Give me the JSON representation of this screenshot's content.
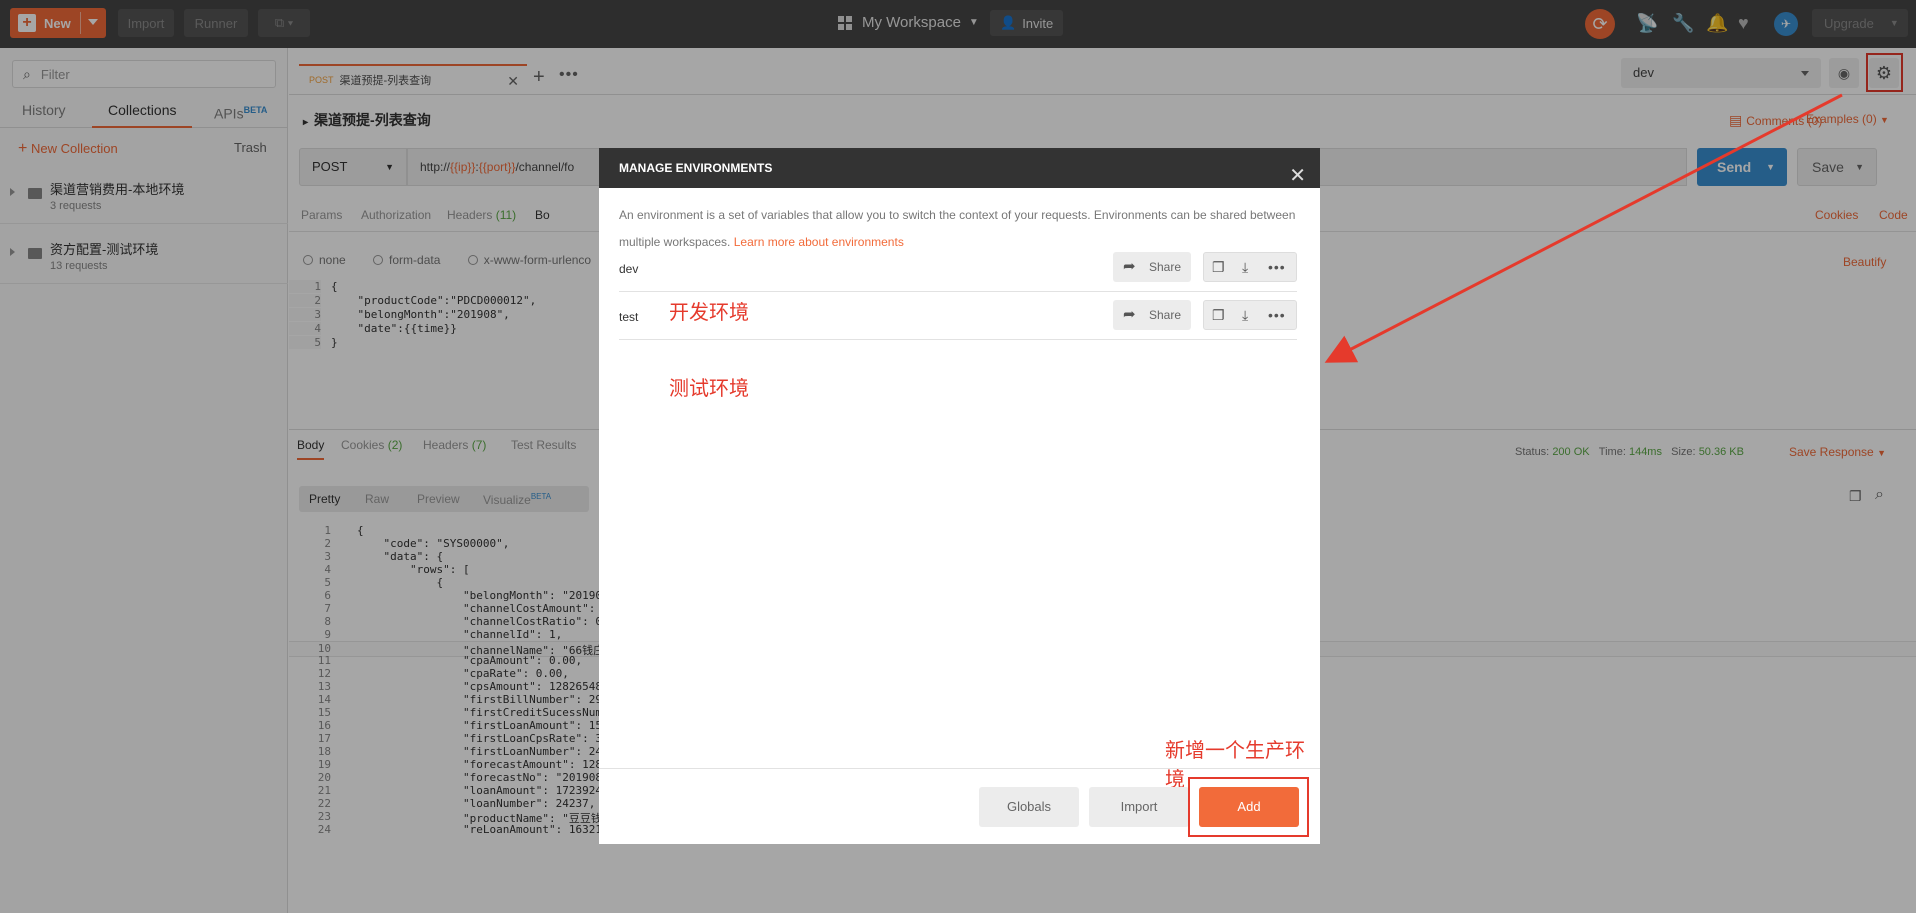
{
  "topbar": {
    "new_label": "New",
    "import_label": "Import",
    "runner_label": "Runner",
    "workspace_label": "My Workspace",
    "invite_label": "Invite",
    "upgrade_label": "Upgrade"
  },
  "sidebar": {
    "filter_placeholder": "Filter",
    "tabs": [
      "History",
      "Collections",
      "APIs"
    ],
    "apis_badge": "BETA",
    "new_collection": "New Collection",
    "trash": "Trash",
    "collections": [
      {
        "name": "渠道营销费用-本地环境",
        "count": "3 requests"
      },
      {
        "name": "资方配置-测试环境",
        "count": "13 requests"
      }
    ]
  },
  "request": {
    "tab_method": "POST",
    "tab_name": "渠道预提-列表查询",
    "title": "渠道预提-列表查询",
    "comments": "Comments (0)",
    "examples": "Examples (0)",
    "method": "POST",
    "url_prefix": "http://",
    "url_var1": "{{ip}}",
    "url_colon": ":",
    "url_var2": "{{port}}",
    "url_suffix": "/channel/fo",
    "send": "Send",
    "save": "Save",
    "env_selected": "dev",
    "subtabs": [
      "Params",
      "Authorization",
      "Headers",
      "(11)",
      "Bo"
    ],
    "cookies": "Cookies",
    "code": "Code",
    "body_modes": [
      "none",
      "form-data",
      "x-www-form-urlenco"
    ],
    "beautify": "Beautify",
    "body_lines": [
      {
        "n": "1",
        "t": "{"
      },
      {
        "n": "2",
        "t": "    \"productCode\":\"PDCD000012\","
      },
      {
        "n": "3",
        "t": "    \"belongMonth\":\"201908\","
      },
      {
        "n": "4",
        "t": "    \"date\":{{time}}"
      },
      {
        "n": "5",
        "t": "}"
      }
    ]
  },
  "response": {
    "tabs": [
      "Body",
      "Cookies",
      "(2)",
      "Headers",
      "(7)",
      "Test Results"
    ],
    "status_label": "Status:",
    "status_value": "200 OK",
    "time_label": "Time:",
    "time_value": "144ms",
    "size_label": "Size:",
    "size_value": "50.36 KB",
    "save_response": "Save Response",
    "view_modes": [
      "Pretty",
      "Raw",
      "Preview",
      "Visualize"
    ],
    "visualize_badge": "BETA",
    "lines": [
      {
        "n": "1",
        "t": "{"
      },
      {
        "n": "2",
        "t": "    \"code\": \"SYS00000\","
      },
      {
        "n": "3",
        "t": "    \"data\": {"
      },
      {
        "n": "4",
        "t": "        \"rows\": ["
      },
      {
        "n": "5",
        "t": "            {"
      },
      {
        "n": "6",
        "t": "                \"belongMonth\": \"20190"
      },
      {
        "n": "7",
        "t": "                \"channelCostAmount\":"
      },
      {
        "n": "8",
        "t": "                \"channelCostRatio\": 0"
      },
      {
        "n": "9",
        "t": "                \"channelId\": 1,"
      },
      {
        "n": "10",
        "t": "                \"channelName\": \"66钱庄"
      },
      {
        "n": "11",
        "t": "                \"cpaAmount\": 0.00,"
      },
      {
        "n": "12",
        "t": "                \"cpaRate\": 0.00,"
      },
      {
        "n": "13",
        "t": "                \"cpsAmount\": 12826548"
      },
      {
        "n": "14",
        "t": "                \"firstBillNumber\": 29"
      },
      {
        "n": "15",
        "t": "                \"firstCreditSucessNum"
      },
      {
        "n": "16",
        "t": "                \"firstLoanAmount\": 15"
      },
      {
        "n": "17",
        "t": "                \"firstLoanCpsRate\": 3"
      },
      {
        "n": "18",
        "t": "                \"firstLoanNumber\": 24"
      },
      {
        "n": "19",
        "t": "                \"forecastAmount\": 128"
      },
      {
        "n": "20",
        "t": "                \"forecastNo\": \"201908"
      },
      {
        "n": "21",
        "t": "                \"loanAmount\": 1723924.95,"
      },
      {
        "n": "22",
        "t": "                \"loanNumber\": 24237,"
      },
      {
        "n": "23",
        "t": "                \"productName\": \"豆豆钱\","
      },
      {
        "n": "24",
        "t": "                \"reLoanAmount\": 1632183.14,"
      }
    ]
  },
  "modal": {
    "title": "MANAGE ENVIRONMENTS",
    "description": "An environment is a set of variables that allow you to switch the context of your requests. Environments can be shared between multiple workspaces.",
    "learn_more": "Learn more about environments",
    "share_label": "Share",
    "environments": [
      {
        "name": "dev"
      },
      {
        "name": "test"
      }
    ],
    "globals": "Globals",
    "import": "Import",
    "add": "Add"
  },
  "annotations": {
    "dev_note": "开发环境",
    "test_note": "测试环境",
    "add_note": "新增一个生产环境"
  },
  "colors": {
    "accent": "#f26b3a",
    "annotation_red": "#e53a2c",
    "send_blue": "#3a8fd1"
  }
}
